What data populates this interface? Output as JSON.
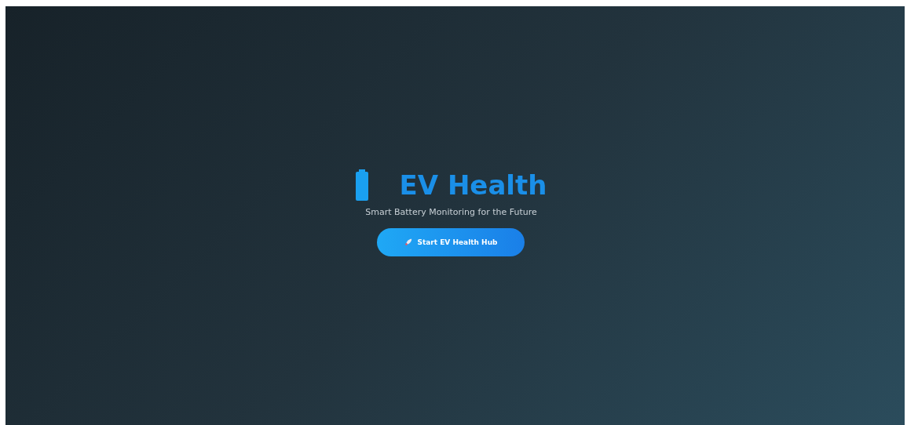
{
  "hero": {
    "title": "EV Health",
    "subtitle": "Smart Battery Monitoring for the Future",
    "button": "Start EV Health Hub"
  }
}
